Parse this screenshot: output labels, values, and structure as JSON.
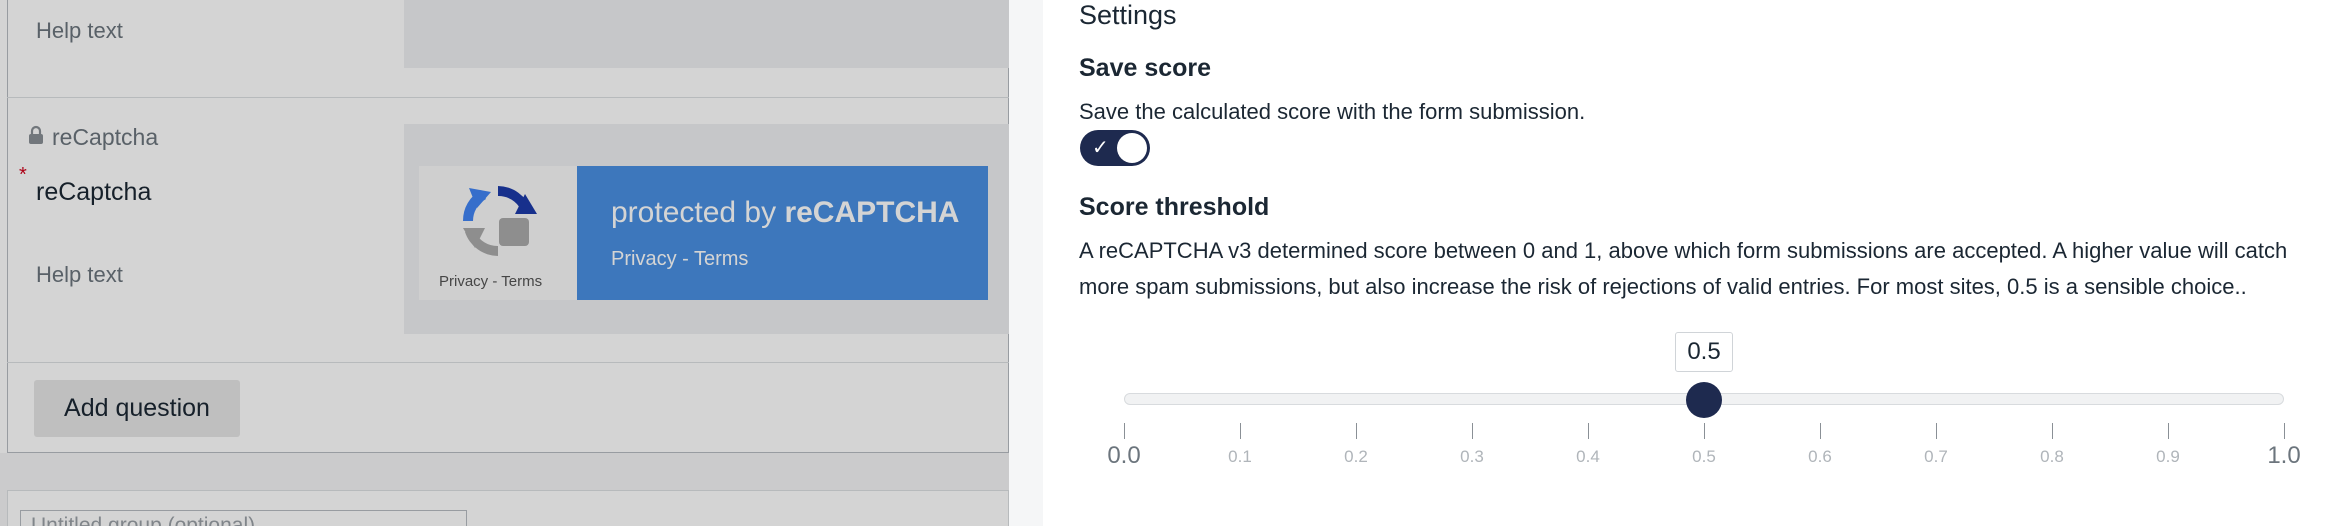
{
  "background": {
    "help_text_1": "Help text",
    "question_lock_label": "reCaptcha",
    "question_title": "reCaptcha",
    "required_marker": "*",
    "help_text_2": "Help text",
    "recaptcha_privacy_terms_small": "Privacy - Terms",
    "recaptcha_protected_prefix": "protected by ",
    "recaptcha_protected_brand": "reCAPTCHA",
    "recaptcha_privacy_terms": "Privacy - Terms",
    "add_question_label": "Add question",
    "group_title_placeholder": "Untitled group (optional)"
  },
  "panel": {
    "title": "Settings",
    "save_score": {
      "heading": "Save score",
      "description": "Save the calculated score with the form submission.",
      "toggle_on": true,
      "check_glyph": "✓"
    },
    "threshold": {
      "heading": "Score threshold",
      "description": "A reCAPTCHA v3 determined score between 0 and 1, above which form submissions are accepted. A higher value will catch more spam submissions, but also increase the risk of rejections of valid entries. For most sites, 0.5 is a sensible choice..",
      "value": 0.5,
      "value_label": "0.5",
      "min": 0,
      "max": 1,
      "ticks": [
        "0.0",
        "0.1",
        "0.2",
        "0.3",
        "0.4",
        "0.5",
        "0.6",
        "0.7",
        "0.8",
        "0.9",
        "1.0"
      ]
    }
  },
  "colors": {
    "accent": "#1e2a4f",
    "recaptcha_blue": "#4a90e2"
  },
  "icons": {
    "lock": "lock-icon",
    "recaptcha_logo": "recaptcha-logo-icon",
    "check": "check-icon"
  }
}
